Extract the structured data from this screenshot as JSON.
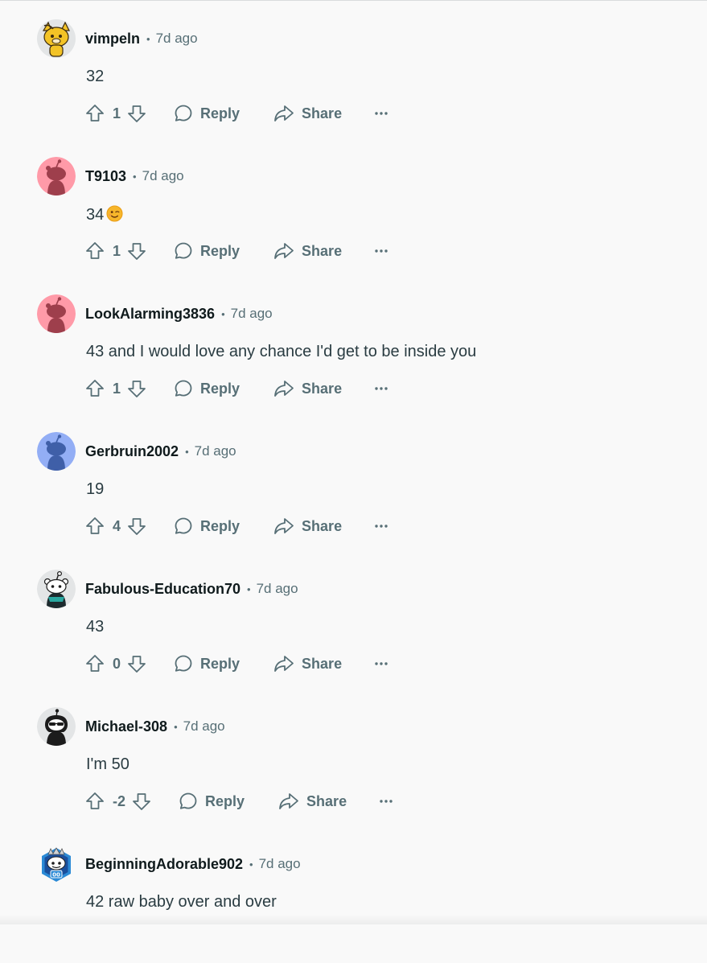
{
  "colors": {
    "background": "#f9f9f9",
    "text": "#0f1a1c",
    "muted": "#576f76"
  },
  "labels": {
    "reply": "Reply",
    "share": "Share",
    "separator": "•"
  },
  "comments": [
    {
      "username": "vimpeln",
      "time": "7d ago",
      "text": "32",
      "score": "1",
      "avatar": "yellow-cat-avatar"
    },
    {
      "username": "T9103",
      "time": "7d ago",
      "text": "34",
      "emoji": "winking-face-emoji",
      "score": "1",
      "avatar": "default-snoo-pink-avatar"
    },
    {
      "username": "LookAlarming3836",
      "time": "7d ago",
      "text": "43 and I would love any chance I'd get to be inside you",
      "score": "1",
      "avatar": "default-snoo-pink-avatar"
    },
    {
      "username": "Gerbruin2002",
      "time": "7d ago",
      "text": "19",
      "score": "4",
      "avatar": "default-snoo-blue-avatar"
    },
    {
      "username": "Fabulous-Education70",
      "time": "7d ago",
      "text": "43",
      "score": "0",
      "avatar": "snoo-character-avatar"
    },
    {
      "username": "Michael-308",
      "time": "7d ago",
      "text": "I'm 50",
      "score": "-2",
      "avatar": "hooded-sunglasses-avatar"
    },
    {
      "username": "BeginningAdorable902",
      "time": "7d ago",
      "text": "42 raw baby over and over",
      "score": "",
      "avatar": "hexagon-badge-avatar"
    }
  ]
}
